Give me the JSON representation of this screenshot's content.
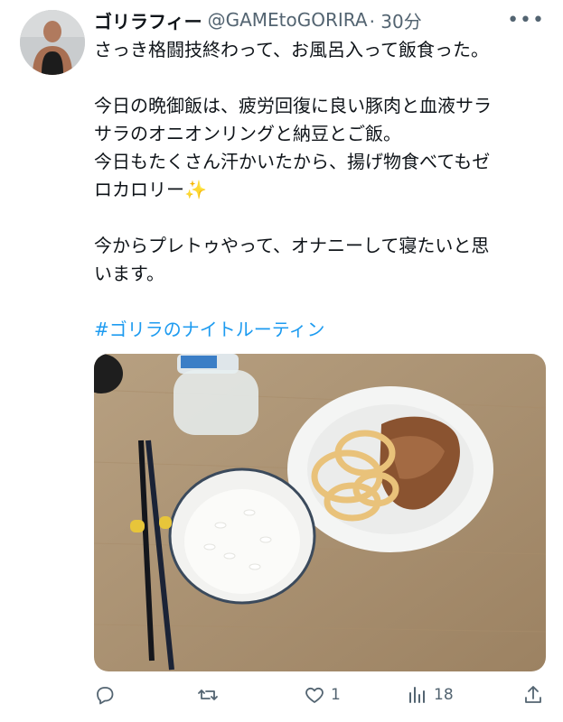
{
  "tweet": {
    "display_name": "ゴリラフィー",
    "handle": "@GAMEtoGORIRA",
    "time": "· 30分",
    "more_icon": "more-horizontal-icon",
    "lines_para1": [
      "さっき格闘技終わって、お風呂入って飯食った。"
    ],
    "lines_para2": [
      "今日の晩御飯は、疲労回復に良い豚肉と血液サラ",
      "サラのオニオンリングと納豆とご飯。",
      "今日もたくさん汗かいたから、揚げ物食べてもゼ",
      "ロカロリー✨"
    ],
    "lines_para3": [
      "今からプレトゥやって、オナニーして寝たいと思",
      "います。"
    ],
    "hashtag": "#ゴリラのナイトルーティン",
    "hashtag_color": "#1d9bf0"
  },
  "actions": {
    "reply_icon": "reply-icon",
    "retweet_icon": "retweet-icon",
    "like_icon": "heart-icon",
    "like_count": "1",
    "views_icon": "bar-chart-icon",
    "views_count": "18",
    "share_icon": "share-icon"
  },
  "colors": {
    "text": "#0f1419",
    "secondary": "#536471",
    "link": "#1d9bf0"
  }
}
